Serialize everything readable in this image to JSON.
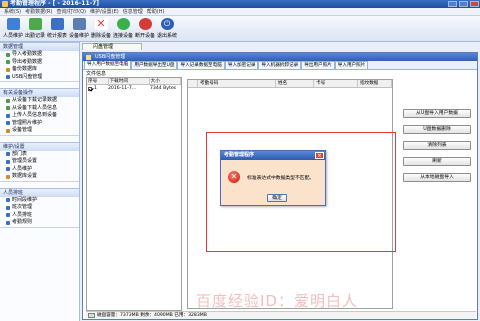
{
  "window": {
    "title": "考勤管理程序 - [ - 2016-11-7]"
  },
  "menu": [
    "系统(S)",
    "考勤数据(R)",
    "查询/打印(Q)",
    "维护/设置(E)",
    "信息管理",
    "帮助(H)"
  ],
  "toolbar": [
    {
      "label": "人员维护",
      "icon": "users-icon",
      "color": "#3f7fd8"
    },
    {
      "label": "出勤记录",
      "icon": "record-icon",
      "color": "#4ea84e"
    },
    {
      "label": "统计报表",
      "icon": "report-icon",
      "color": "#3c6fc7"
    },
    {
      "label": "设备维护",
      "icon": "device-icon",
      "color": "#5a7db2"
    },
    {
      "label": "删除设备",
      "icon": "delete-icon",
      "color": "#d54545"
    },
    {
      "label": "连接设备",
      "icon": "connect-icon",
      "color": "#3bb04a"
    },
    {
      "label": "断开设备",
      "icon": "disconnect-icon",
      "color": "#d43a3a"
    },
    {
      "label": "退出系统",
      "icon": "power-icon",
      "color": "#2b5fbc"
    }
  ],
  "sidebar": {
    "groups": [
      {
        "title": "数据管理",
        "items": [
          {
            "label": "导入考勤数据",
            "color": "#4a9b4a"
          },
          {
            "label": "导出考勤数据",
            "color": "#4a9b4a"
          },
          {
            "label": "备份数据库",
            "color": "#d08a2a"
          },
          {
            "label": "USB闪盘管理",
            "color": "#3a6fc4"
          }
        ]
      },
      {
        "title": "有关设备操作",
        "items": [
          {
            "label": "从设备下载记录数据",
            "color": "#4a9b4a"
          },
          {
            "label": "从设备下载人员信息",
            "color": "#4a9b4a"
          },
          {
            "label": "上传人员信息到设备",
            "color": "#3a6fc4"
          },
          {
            "label": "管理照片维护",
            "color": "#3a6fc4"
          },
          {
            "label": "设备管理",
            "color": "#d08a2a"
          }
        ]
      },
      {
        "title": "维护/设置",
        "items": [
          {
            "label": "部门表",
            "color": "#3a6fc4"
          },
          {
            "label": "管理员设置",
            "color": "#3a6fc4"
          },
          {
            "label": "人员维护",
            "color": "#3a6fc4"
          },
          {
            "label": "数据库设置",
            "color": "#d08a2a"
          }
        ]
      },
      {
        "title": "人员排班",
        "items": [
          {
            "label": "时间段维护",
            "color": "#3a6fc4"
          },
          {
            "label": "班次管理",
            "color": "#3a6fc4"
          },
          {
            "label": "人员排班",
            "color": "#3a6fc4"
          },
          {
            "label": "考勤规则",
            "color": "#3a6fc4"
          }
        ]
      }
    ]
  },
  "doc_tab": {
    "label": "闪盘管理"
  },
  "sub_window": {
    "title": "USB闪盘管理",
    "tabs": [
      "导入用户数据至电脑",
      "用户数据导出至U盘",
      "导入记录数据至电脑",
      "导入加密记录",
      "导入机器拆卸记录",
      "导出用户照片",
      "导入用户照片"
    ],
    "file_info_label": "文件信息",
    "file_columns": [
      "序号",
      "下载时间",
      "大小"
    ],
    "file_rows": [
      {
        "index": "1",
        "time": "2016-11-7...",
        "size": "7344 Bytes"
      }
    ],
    "user_columns": [
      "考勤号码",
      "姓名",
      "卡号",
      "指纹数据"
    ],
    "buttons": [
      "从U盘导入用户数据",
      "U盘数据删除",
      "清除列表",
      "刷新",
      "从本地磁盘导入"
    ],
    "status": "磁盘容量：7373MB   剩余：4090MB   已用：3283MB"
  },
  "dialog": {
    "title": "考勤管理程序",
    "message": "标准表达式中数据类型不匹配。",
    "ok_label": "确定",
    "close_label": "×"
  },
  "watermark": "百度经验ID：爱明白人"
}
